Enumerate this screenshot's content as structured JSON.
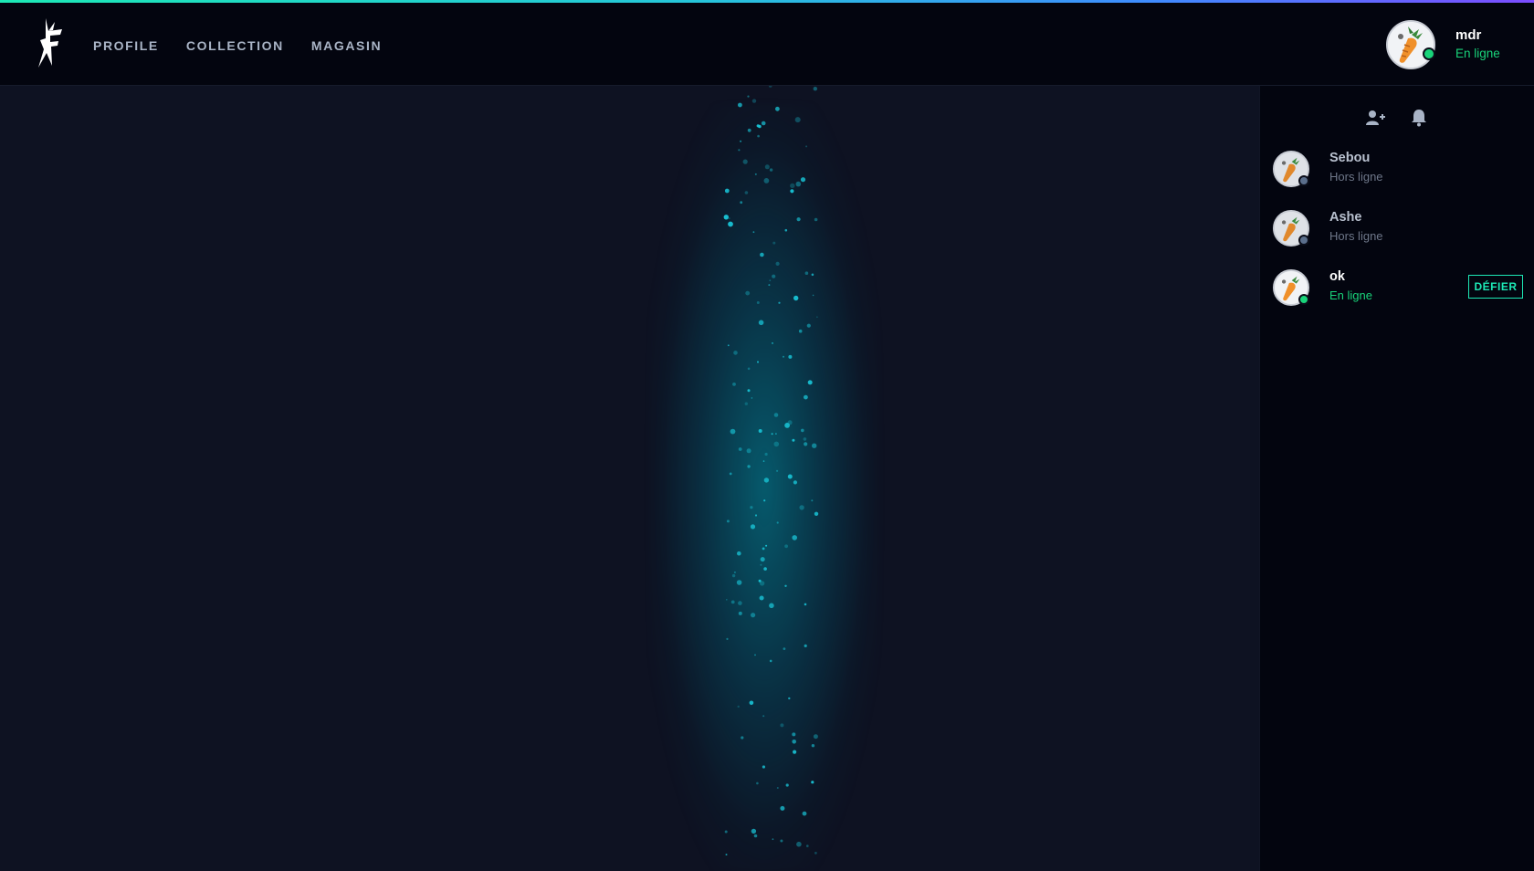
{
  "nav": {
    "items": [
      {
        "label": "PROFILE"
      },
      {
        "label": "COLLECTION"
      },
      {
        "label": "MAGASIN"
      }
    ]
  },
  "user": {
    "name": "mdr",
    "status": "En ligne",
    "avatar_icon": "carrot-avatar-icon"
  },
  "sidebar": {
    "actions": [
      {
        "icon": "add-friend-icon"
      },
      {
        "icon": "bell-icon"
      }
    ],
    "friends": [
      {
        "name": "Sebou",
        "status": "Hors ligne",
        "online": false
      },
      {
        "name": "Ashe",
        "status": "Hors ligne",
        "online": false
      },
      {
        "name": "ok",
        "status": "En ligne",
        "online": true,
        "action_label": "DÉFIER"
      }
    ]
  },
  "colors": {
    "background": "#0e1222",
    "header": "#03050f",
    "accent": "#1de9b6",
    "online": "#19d47a",
    "offline": "#5b6f8c",
    "particles": "#19c6d8"
  }
}
